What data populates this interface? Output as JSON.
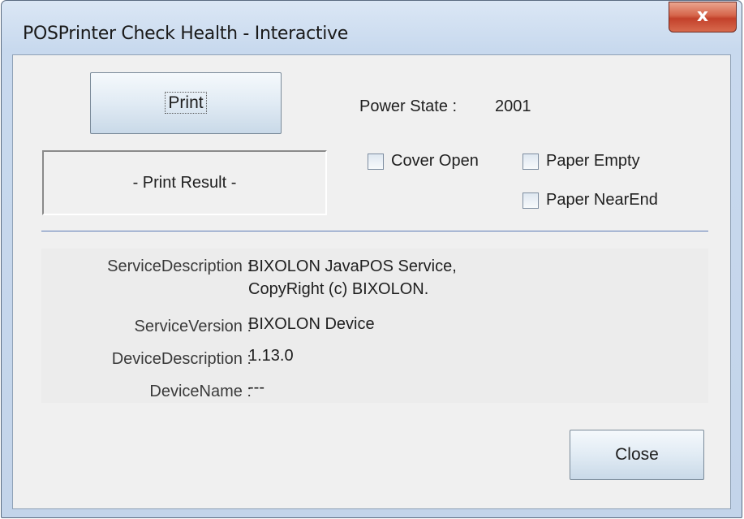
{
  "window": {
    "title": "POSPrinter Check Health - Interactive",
    "close_glyph": "x"
  },
  "print_button": {
    "label": "Print"
  },
  "print_result": {
    "text": "- Print Result -"
  },
  "power_state": {
    "label": "Power State :",
    "value": "2001"
  },
  "checkboxes": [
    {
      "label": "Cover Open",
      "checked": false
    },
    {
      "label": "Paper Empty",
      "checked": false
    },
    {
      "label": "Paper NearEnd",
      "checked": false
    }
  ],
  "info": [
    {
      "key": "ServiceDescription :",
      "value_lines": [
        "BIXOLON JavaPOS Service,",
        "CopyRight (c) BIXOLON."
      ]
    },
    {
      "key": "ServiceVersion :",
      "value_lines": [
        "BIXOLON Device"
      ]
    },
    {
      "key": "DeviceDescription :",
      "value_lines": [
        "1.13.0"
      ]
    },
    {
      "key": "DeviceName :",
      "value_lines": [
        "---"
      ]
    }
  ],
  "close_button": {
    "label": "Close"
  },
  "colors": {
    "separator": "#5b79b5",
    "titlebar": "#dbe7f5",
    "close_red": "#c3412b"
  }
}
